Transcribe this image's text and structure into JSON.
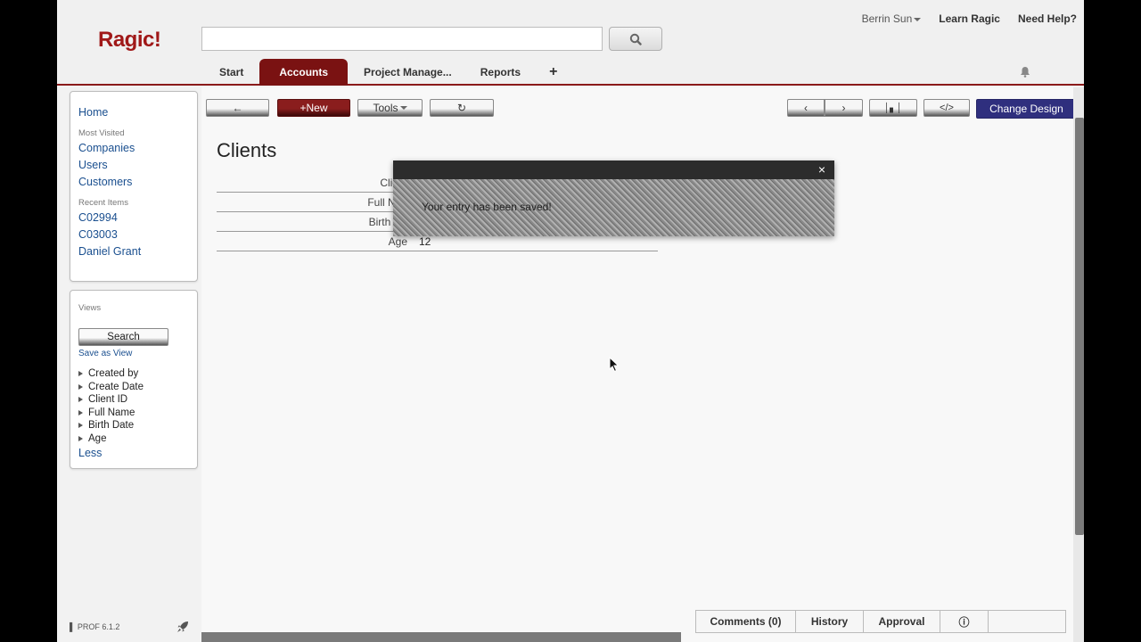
{
  "header": {
    "logo": "Ragic!",
    "search": {
      "value": "",
      "placeholder": ""
    },
    "user_name": "Berrin Sun",
    "learn_link": "Learn Ragic",
    "help_link": "Need Help?"
  },
  "tabs": [
    {
      "label": "Start",
      "active": false
    },
    {
      "label": "Accounts",
      "active": true
    },
    {
      "label": "Project Manage...",
      "active": false
    },
    {
      "label": "Reports",
      "active": false
    },
    {
      "label": "+",
      "active": false
    }
  ],
  "sidebar": {
    "home": "Home",
    "most_visited_heading": "Most Visited",
    "most_visited": [
      "Companies",
      "Users",
      "Customers"
    ],
    "recent_heading": "Recent Items",
    "recent": [
      "C02994",
      "C03003",
      "Daniel Grant"
    ],
    "views_heading": "Views",
    "search_button": "Search",
    "save_as_view": "Save as View",
    "filters": [
      "Created by",
      "Create Date",
      "Client ID",
      "Full Name",
      "Birth Date",
      "Age"
    ],
    "less": "Less",
    "version": "PROF 6.1.2"
  },
  "toolbar": {
    "back": "←",
    "new": "+New",
    "tools": "Tools",
    "refresh": "↻",
    "prev": "‹",
    "next": "›",
    "chart": "│▖│",
    "embed": "</>",
    "change_design": "Change Design"
  },
  "page": {
    "title": "Clients",
    "fields": [
      {
        "label": "Client",
        "value": ""
      },
      {
        "label": "Full Nan",
        "value": ""
      },
      {
        "label": "Birth Da",
        "value": ""
      },
      {
        "label": "Age",
        "value": "12"
      }
    ]
  },
  "modal": {
    "message": "Your entry has been saved!",
    "close": "×"
  },
  "bottom_tabs": [
    "Comments (0)",
    "History",
    "Approval",
    "ⓘ",
    ""
  ],
  "icons": {
    "search": "search-icon",
    "bell": "bell-icon",
    "rocket": "rocket-icon"
  },
  "colors": {
    "brand": "#a01818",
    "active_tab": "#7a1212",
    "link": "#1a4f8f",
    "change_design": "#2f2f7e"
  }
}
